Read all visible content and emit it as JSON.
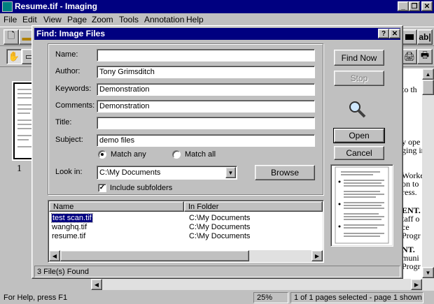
{
  "window": {
    "title": "Resume.tif - Imaging"
  },
  "menu": [
    "File",
    "Edit",
    "View",
    "Page",
    "Zoom",
    "Tools",
    "Annotation",
    "Help"
  ],
  "toolbar": {
    "text_tool_label": "ab|"
  },
  "thumbnail": {
    "page_number": "1"
  },
  "document_fragments": [
    "to th",
    "y ope",
    "ging in",
    "Worke",
    "on to",
    "ress.",
    "ENT.",
    "taff o",
    "ce",
    "Progr",
    "NT.",
    "muni",
    "Progr"
  ],
  "statusbar": {
    "help": "For Help, press F1",
    "zoom": "25%",
    "pages": "1 of 1 pages selected - page 1 shown"
  },
  "dialog": {
    "title": "Find: Image Files",
    "fields": {
      "name": {
        "label": "Name:",
        "value": ""
      },
      "author": {
        "label": "Author:",
        "value": "Tony Grimsditch"
      },
      "keywords": {
        "label": "Keywords:",
        "value": "Demonstration"
      },
      "comments": {
        "label": "Comments:",
        "value": "Demonstration"
      },
      "title": {
        "label": "Title:",
        "value": ""
      },
      "subject": {
        "label": "Subject:",
        "value": "demo files"
      }
    },
    "match_any": "Match any",
    "match_all": "Match all",
    "match_selected": "any",
    "look_in": {
      "label": "Look in:",
      "value": "C:\\My Documents"
    },
    "browse": "Browse",
    "include_subfolders": {
      "label": "Include subfolders",
      "checked": true
    },
    "buttons": {
      "find_now": "Find Now",
      "stop": "Stop",
      "open": "Open",
      "cancel": "Cancel"
    },
    "results": {
      "columns": [
        "Name",
        "In Folder"
      ],
      "rows": [
        {
          "name": "test scan.tif",
          "folder": "C:\\My Documents",
          "selected": true
        },
        {
          "name": "wanghq.tif",
          "folder": "C:\\My Documents",
          "selected": false
        },
        {
          "name": "resume.tif",
          "folder": "C:\\My Documents",
          "selected": false
        }
      ]
    },
    "status": "3 File(s) Found"
  },
  "colors": {
    "titlebar": "#000080",
    "face": "#c0c0c0",
    "selection": "#000080"
  }
}
